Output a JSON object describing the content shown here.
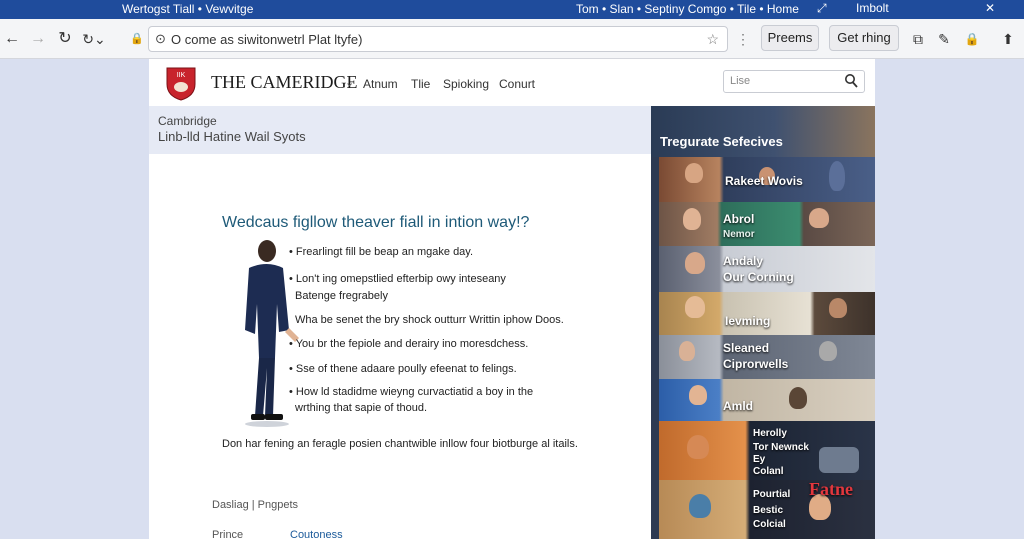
{
  "titlebar": {
    "left_text": "Wertogst Tiall  •  Vewvitge",
    "right_text": "Tom  •  Slan  •  Septiny Comgo  •  Tile  •  Home",
    "right_links": [
      "⤢",
      "Imbolt"
    ],
    "close": "✕"
  },
  "toolbar": {
    "back": "←",
    "forward": "→",
    "reload": "↻",
    "history": "↻⌄",
    "lock": "🔒",
    "url": "O come as siwitonwetrl Plat ltyfe)",
    "star": "☆",
    "menu_dots": "⋮",
    "btn1": "Preems",
    "btn2": "Get rhing",
    "icons": [
      "⧉",
      "✎",
      "🔒",
      "⬆"
    ]
  },
  "site": {
    "brand": "THE CAMERIDGE",
    "brand_caret": "⌄",
    "nav": [
      "Atnum",
      "Tlie",
      "Spioking",
      "Conurt"
    ],
    "search_placeholder": "Lise",
    "shield_text": "IIK"
  },
  "crumbs": {
    "line1": "Cambridge",
    "line2": "Linb-lld Hatine Wail Syots"
  },
  "article": {
    "title": "Wedcaus figllow theaver fiall in intion way!?",
    "bullets": [
      "Frearlingt fill be beap an mgake day.",
      "Lon't ing omepstlied efterbip owy inteseany",
      "Batenge fregrabely",
      "Wha be senet the bry shock outturr Writtin iphow Doos.",
      "You br the fepiole and derairy ino moresdchess.",
      "Sse of thene adaare poully efeenat to felings.",
      "How ld stadidme wieyng curvactiatid a boy in the",
      "wrthing that sapie of thoud."
    ],
    "closing": "Don har fening an feragle posien chantwible inllow four biotburge al itails.",
    "footer_left": "Dasliag  |  Pngpets",
    "footer_bottom_left": "Prince",
    "footer_bottom_link": "Coutoness"
  },
  "panel": {
    "header": "Tregurate Sefecives",
    "tiles": [
      {
        "label": "Rakeet Wovis"
      },
      {
        "label": "Abrol",
        "sub": "Nemor"
      },
      {
        "label": "Andaly"
      },
      {
        "label": "Our Corning"
      },
      {
        "label": "Ievming"
      },
      {
        "label": "Sleaned"
      },
      {
        "label": "Ciprorwells"
      },
      {
        "label": "Amld"
      },
      {
        "label": "Herolly",
        "sub2": "Tor Newnck",
        "sub3": "Ey",
        "sub4": "Colanl"
      },
      {
        "label": "Pourtial",
        "sub2": "Bestic",
        "sub3": "Colcial",
        "accent": "Fatne"
      }
    ]
  },
  "colors": {
    "titlebar": "#1f4c9c",
    "article_title": "#1e5a78",
    "panel_bg": "#2d3a52",
    "accent_red": "#e2373d"
  }
}
